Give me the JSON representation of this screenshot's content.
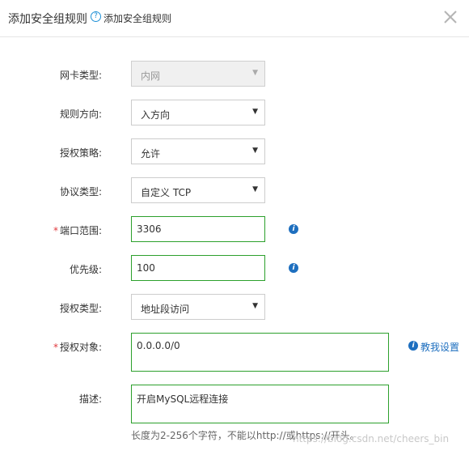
{
  "dialog": {
    "title": "添加安全组规则",
    "help_icon": "question-circle-icon",
    "help_text": "添加安全组规则",
    "close_icon": "close-icon"
  },
  "form": {
    "nic_type": {
      "label": "网卡类型:",
      "value": "内网",
      "disabled": true
    },
    "direction": {
      "label": "规则方向:",
      "value": "入方向"
    },
    "policy": {
      "label": "授权策略:",
      "value": "允许"
    },
    "protocol": {
      "label": "协议类型:",
      "value": "自定义 TCP"
    },
    "port_range": {
      "required_mark": "*",
      "label": "端口范围:",
      "value": "3306",
      "info_icon": "info-icon"
    },
    "priority": {
      "label": "优先级:",
      "value": "100",
      "info_icon": "info-icon"
    },
    "auth_type": {
      "label": "授权类型:",
      "value": "地址段访问"
    },
    "auth_object": {
      "required_mark": "*",
      "label": "授权对象:",
      "value": "0.0.0.0/0",
      "help_link": "教我设置",
      "info_icon": "info-icon"
    },
    "description": {
      "label": "描述:",
      "value": "开启MySQL远程连接",
      "hint": "长度为2-256个字符，不能以http://或https://开头。"
    }
  },
  "watermark": "https://blog.csdn.net/cheers_bin",
  "colors": {
    "accent": "#1e6fbf",
    "valid_border": "#2ca02c",
    "required": "#e0393e"
  }
}
